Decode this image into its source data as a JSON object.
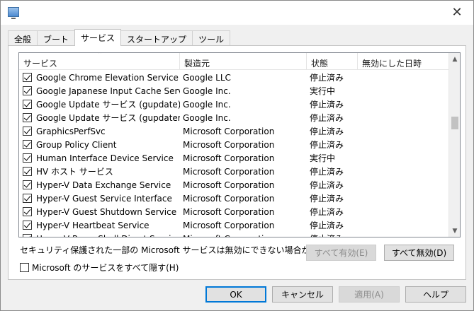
{
  "window": {
    "close_glyph": "✕"
  },
  "tabs": [
    {
      "label": "全般",
      "active": false
    },
    {
      "label": "ブート",
      "active": false
    },
    {
      "label": "サービス",
      "active": true
    },
    {
      "label": "スタートアップ",
      "active": false
    },
    {
      "label": "ツール",
      "active": false
    }
  ],
  "table": {
    "sort_glyph": "⌃",
    "columns": [
      "サービス",
      "製造元",
      "状態",
      "無効にした日時"
    ],
    "rows": [
      {
        "name": "Google Chrome Elevation Service",
        "maker": "Google LLC",
        "status": "停止済み",
        "disabled_date": "",
        "checked": true
      },
      {
        "name": "Google Japanese Input Cache Service",
        "maker": "Google Inc.",
        "status": "実行中",
        "disabled_date": "",
        "checked": true
      },
      {
        "name": "Google Update サービス (gupdate)",
        "maker": "Google Inc.",
        "status": "停止済み",
        "disabled_date": "",
        "checked": true
      },
      {
        "name": "Google Update サービス (gupdatem)",
        "maker": "Google Inc.",
        "status": "停止済み",
        "disabled_date": "",
        "checked": true
      },
      {
        "name": "GraphicsPerfSvc",
        "maker": "Microsoft Corporation",
        "status": "停止済み",
        "disabled_date": "",
        "checked": true
      },
      {
        "name": "Group Policy Client",
        "maker": "Microsoft Corporation",
        "status": "停止済み",
        "disabled_date": "",
        "checked": true
      },
      {
        "name": "Human Interface Device Service",
        "maker": "Microsoft Corporation",
        "status": "実行中",
        "disabled_date": "",
        "checked": true
      },
      {
        "name": "HV ホスト サービス",
        "maker": "Microsoft Corporation",
        "status": "停止済み",
        "disabled_date": "",
        "checked": true
      },
      {
        "name": "Hyper-V Data Exchange Service",
        "maker": "Microsoft Corporation",
        "status": "停止済み",
        "disabled_date": "",
        "checked": true
      },
      {
        "name": "Hyper-V Guest Service Interface",
        "maker": "Microsoft Corporation",
        "status": "停止済み",
        "disabled_date": "",
        "checked": true
      },
      {
        "name": "Hyper-V Guest Shutdown Service",
        "maker": "Microsoft Corporation",
        "status": "停止済み",
        "disabled_date": "",
        "checked": true
      },
      {
        "name": "Hyper-V Heartbeat Service",
        "maker": "Microsoft Corporation",
        "status": "停止済み",
        "disabled_date": "",
        "checked": true
      },
      {
        "name": "Hyper-V PowerShell Direct Service",
        "maker": "Microsoft Corporation",
        "status": "停止済み",
        "disabled_date": "",
        "checked": true
      }
    ]
  },
  "note": "セキュリティ保護された一部の Microsoft サービスは無効にできない場合があります。",
  "buttons": {
    "enable_all": "すべて有効(E)",
    "disable_all": "すべて無効(D)",
    "ok": "OK",
    "cancel": "キャンセル",
    "apply": "適用(A)",
    "help": "ヘルプ"
  },
  "hide_ms": {
    "label": "Microsoft のサービスをすべて隠す(H)",
    "checked": false
  }
}
